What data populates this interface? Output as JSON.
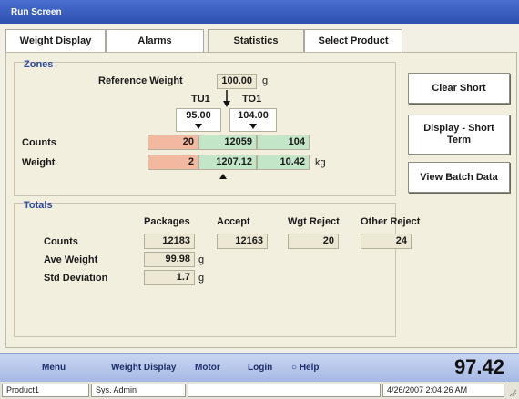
{
  "window": {
    "title": "Run Screen"
  },
  "tabs": [
    {
      "label": "Weight Display"
    },
    {
      "label": "Alarms"
    },
    {
      "label": "Statistics"
    },
    {
      "label": "Select Product"
    }
  ],
  "zones": {
    "title": "Zones",
    "reference_weight_label": "Reference Weight",
    "reference_weight_value": "100.00",
    "reference_weight_unit": "g",
    "tu1_label": "TU1",
    "to1_label": "TO1",
    "tu1_value": "95.00",
    "to1_value": "104.00",
    "counts_label": "Counts",
    "weight_label": "Weight",
    "counts": {
      "under": "20",
      "accept": "12059",
      "over": "104"
    },
    "weight": {
      "under": "2",
      "accept": "1207.12",
      "over": "10.42",
      "unit": "kg"
    }
  },
  "buttons": {
    "clear_short": "Clear Short",
    "display_short_term": "Display - Short Term",
    "view_batch_data": "View Batch Data"
  },
  "totals": {
    "title": "Totals",
    "headers": {
      "packages": "Packages",
      "accept": "Accept",
      "wgt_reject": "Wgt Reject",
      "other_reject": "Other Reject"
    },
    "counts_label": "Counts",
    "counts": {
      "packages": "12183",
      "accept": "12163",
      "wgt_reject": "20",
      "other_reject": "24"
    },
    "ave_weight_label": "Ave Weight",
    "ave_weight_value": "99.98",
    "ave_weight_unit": "g",
    "std_dev_label": "Std Deviation",
    "std_dev_value": "1.7",
    "std_dev_unit": "g"
  },
  "nav": {
    "menu": "Menu",
    "weight_display": "Weight Display",
    "motor": "Motor",
    "login": "Login",
    "help": "Help",
    "current_weight": "97.42"
  },
  "status": {
    "product": "Product1",
    "user": "Sys. Admin",
    "datetime": "4/26/2007 2:04:26 AM"
  }
}
